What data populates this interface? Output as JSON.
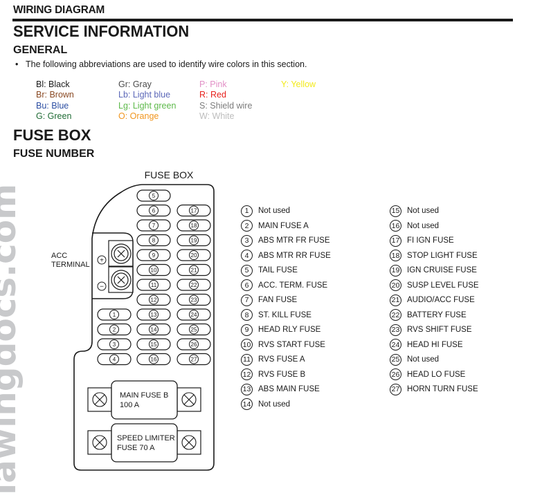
{
  "header": {
    "section": "WIRING DIAGRAM",
    "title": "SERVICE INFORMATION"
  },
  "general": {
    "heading": "GENERAL",
    "bullet": "•",
    "intro": "The following abbreviations are used to identify wire colors in this section."
  },
  "wire_colors": [
    {
      "label": "Bl: Black",
      "color": "#1a1a1a"
    },
    {
      "label": "Br: Brown",
      "color": "#8a4a24"
    },
    {
      "label": "Bu: Blue",
      "color": "#2d4fa3"
    },
    {
      "label": "G: Green",
      "color": "#1f6b35"
    },
    {
      "label": "Gr: Gray",
      "color": "#4a4a4a"
    },
    {
      "label": "Lb: Light blue",
      "color": "#5b67b8"
    },
    {
      "label": "Lg: Light green",
      "color": "#5db94a"
    },
    {
      "label": "O: Orange",
      "color": "#f0961e"
    },
    {
      "label": "P: Pink",
      "color": "#e28fc6"
    },
    {
      "label": "R: Red",
      "color": "#e8201c"
    },
    {
      "label": "S: Shield wire",
      "color": "#7c7c7c"
    },
    {
      "label": "W: White",
      "color": "#bdbdbd"
    },
    {
      "label": "Y: Yellow",
      "color": "#f3ea1a"
    }
  ],
  "fuse_box": {
    "heading": "FUSE BOX",
    "subheading": "FUSE NUMBER",
    "diagram_title": "FUSE BOX",
    "acc_terminal": [
      "ACC",
      "TERMINAL"
    ],
    "plus": "+",
    "minus": "−",
    "main_fuse_b": [
      "MAIN FUSE B",
      "100 A"
    ],
    "speed_limiter": [
      "SPEED LIMITER",
      "FUSE  70 A"
    ]
  },
  "fuses": [
    {
      "num": "1",
      "name": "Not used"
    },
    {
      "num": "2",
      "name": "MAIN FUSE A"
    },
    {
      "num": "3",
      "name": "ABS MTR FR FUSE"
    },
    {
      "num": "4",
      "name": "ABS MTR RR FUSE"
    },
    {
      "num": "5",
      "name": "TAIL FUSE"
    },
    {
      "num": "6",
      "name": "ACC. TERM. FUSE"
    },
    {
      "num": "7",
      "name": "FAN FUSE"
    },
    {
      "num": "8",
      "name": "ST. KILL FUSE"
    },
    {
      "num": "9",
      "name": "HEAD RLY FUSE"
    },
    {
      "num": "10",
      "name": "RVS START FUSE"
    },
    {
      "num": "11",
      "name": "RVS FUSE A"
    },
    {
      "num": "12",
      "name": "RVS FUSE B"
    },
    {
      "num": "13",
      "name": "ABS MAIN FUSE"
    },
    {
      "num": "14",
      "name": "Not used"
    },
    {
      "num": "15",
      "name": "Not used"
    },
    {
      "num": "16",
      "name": "Not used"
    },
    {
      "num": "17",
      "name": "FI IGN FUSE"
    },
    {
      "num": "18",
      "name": "STOP LIGHT FUSE"
    },
    {
      "num": "19",
      "name": "IGN CRUISE FUSE"
    },
    {
      "num": "20",
      "name": "SUSP LEVEL FUSE"
    },
    {
      "num": "21",
      "name": "AUDIO/ACC FUSE"
    },
    {
      "num": "22",
      "name": "BATTERY FUSE"
    },
    {
      "num": "23",
      "name": "RVS SHIFT FUSE"
    },
    {
      "num": "24",
      "name": "HEAD HI FUSE"
    },
    {
      "num": "25",
      "name": "Not used"
    },
    {
      "num": "26",
      "name": "HEAD LO FUSE"
    },
    {
      "num": "27",
      "name": "HORN TURN FUSE"
    }
  ],
  "watermark": "iawingdocs.com"
}
